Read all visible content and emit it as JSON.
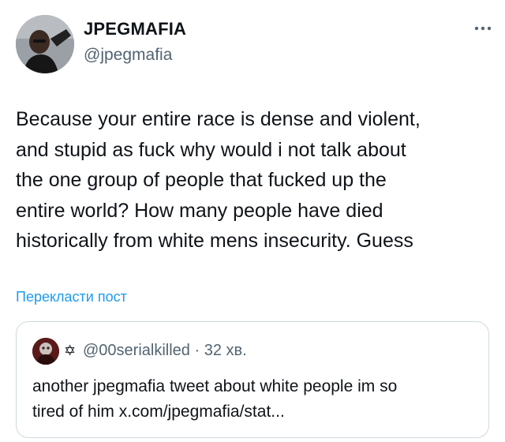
{
  "tweet": {
    "author_name": "JPEGMAFIA",
    "author_handle": "@jpegmafia",
    "text": "Because your entire race is dense and violent,\nand stupid as fuck why would i not talk about\nthe one group of people that fucked up the\nentire world? How many people have died\nhistorically from white mens insecurity. Guess",
    "translate_label": "Перекласти пост"
  },
  "quoted": {
    "star_glyph": "✡",
    "handle": "@00serialkilled",
    "separator": "·",
    "time": "32 хв.",
    "text": "another jpegmafia tweet about white people im so\ntired of him x.com/jpegmafia/stat..."
  },
  "icons": {
    "more": "more-horizontal-icon",
    "avatar": "user-avatar",
    "quote_avatar": "quoted-user-avatar"
  },
  "colors": {
    "text": "#0f1419",
    "secondary": "#536471",
    "link": "#1d9bf0",
    "border": "#cfd9de"
  }
}
